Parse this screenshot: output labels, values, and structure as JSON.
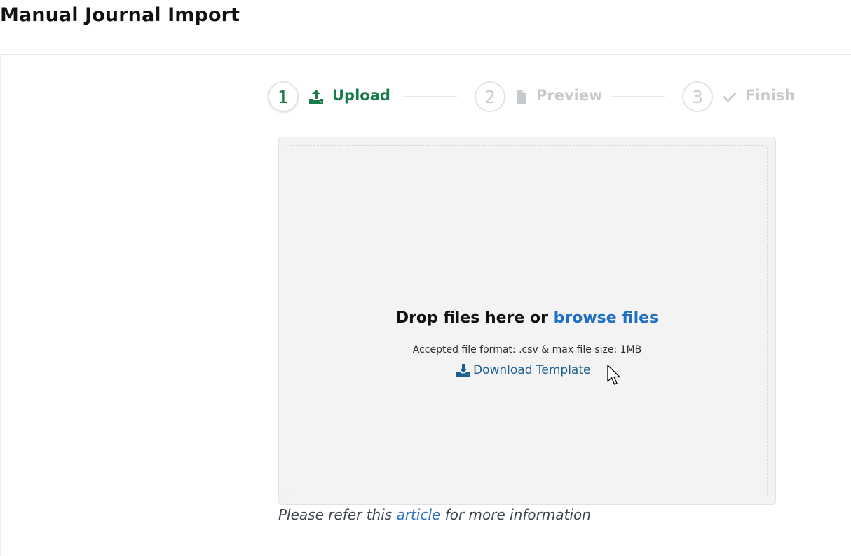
{
  "page": {
    "title": "Manual Journal Import"
  },
  "stepper": {
    "steps": [
      {
        "number": "1",
        "label": "Upload",
        "icon": "upload-icon",
        "state": "active"
      },
      {
        "number": "2",
        "label": "Preview",
        "icon": "file-icon",
        "state": "inactive"
      },
      {
        "number": "3",
        "label": "Finish",
        "icon": "check-icon",
        "state": "inactive"
      }
    ]
  },
  "dropzone": {
    "heading_prefix": "Drop files here or ",
    "browse_label": "browse files",
    "accepted_text": "Accepted file format: .csv & max file size: 1MB",
    "download_label": "Download Template"
  },
  "info": {
    "prefix": "Please refer this ",
    "link_label": "article",
    "suffix": " for more information"
  },
  "colors": {
    "active_step": "#197a4a",
    "inactive_step": "#c6c9ce",
    "link_blue": "#1f6fc5",
    "download_blue": "#1a5f8f",
    "dropzone_bg": "#f3f3f3"
  }
}
